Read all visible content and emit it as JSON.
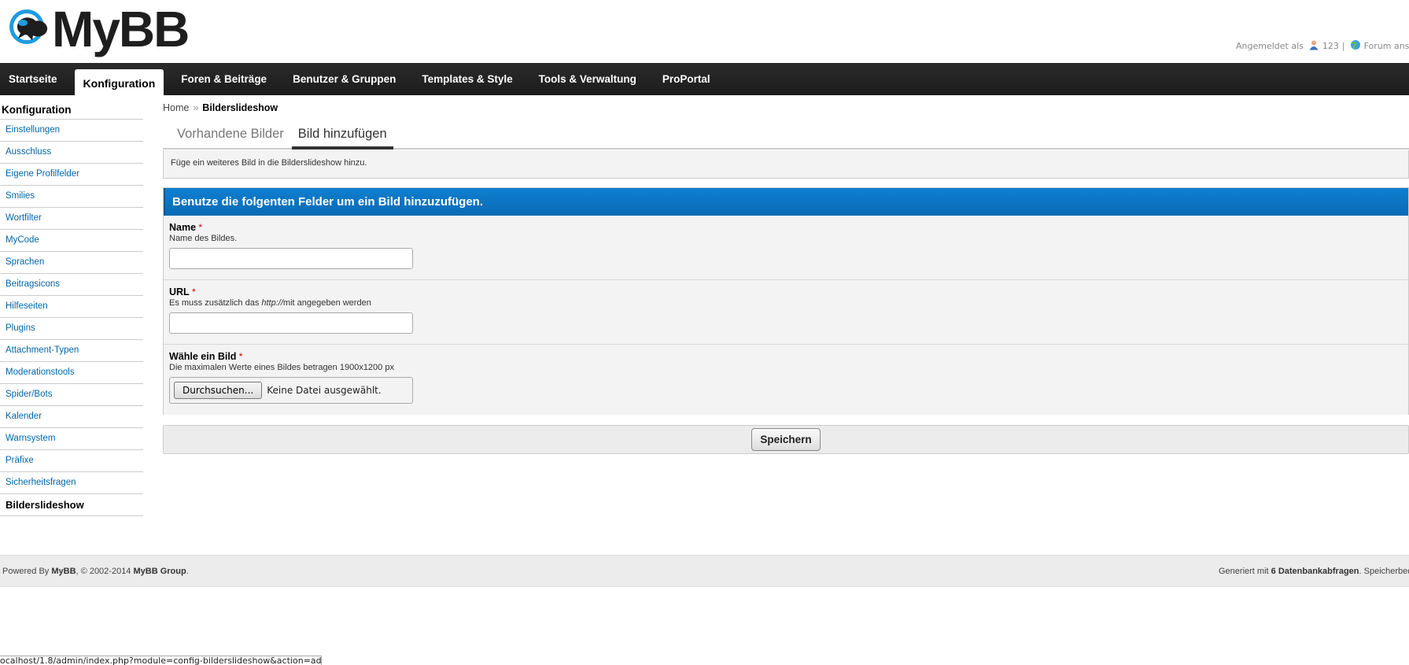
{
  "brand": {
    "name": "MyBB"
  },
  "user": {
    "logged_in_label": "Angemeldet als",
    "username": "123",
    "separator": "|",
    "view_forum": "Forum ansehen"
  },
  "nav": {
    "items": [
      {
        "label": "Startseite"
      },
      {
        "label": "Konfiguration"
      },
      {
        "label": "Foren & Beiträge"
      },
      {
        "label": "Benutzer & Gruppen"
      },
      {
        "label": "Templates & Style"
      },
      {
        "label": "Tools & Verwaltung"
      },
      {
        "label": "ProPortal"
      }
    ],
    "active": "Konfiguration"
  },
  "sidebar": {
    "title": "Konfiguration",
    "items": [
      {
        "label": "Einstellungen"
      },
      {
        "label": "Ausschluss"
      },
      {
        "label": "Eigene Profilfelder"
      },
      {
        "label": "Smilies"
      },
      {
        "label": "Wortfilter"
      },
      {
        "label": "MyCode"
      },
      {
        "label": "Sprachen"
      },
      {
        "label": "Beitragsicons"
      },
      {
        "label": "Hilfeseiten"
      },
      {
        "label": "Plugins"
      },
      {
        "label": "Attachment-Typen"
      },
      {
        "label": "Moderationstools"
      },
      {
        "label": "Spider/Bots"
      },
      {
        "label": "Kalender"
      },
      {
        "label": "Warnsystem"
      },
      {
        "label": "Präfixe"
      },
      {
        "label": "Sicherheitsfragen"
      },
      {
        "label": "Bilderslideshow"
      }
    ],
    "active": "Bilderslideshow"
  },
  "breadcrumb": {
    "home": "Home",
    "separator": "»",
    "current": "Bilderslideshow"
  },
  "tabs": [
    {
      "label": "Vorhandene Bilder"
    },
    {
      "label": "Bild hinzufügen"
    }
  ],
  "notice": "Füge ein weiteres Bild in die Bilderslideshow hinzu.",
  "form": {
    "heading": "Benutze die folgenten Felder um ein Bild hinzuzufügen.",
    "required_marker": "*",
    "name": {
      "label": "Name",
      "description": "Name des Bildes.",
      "value": ""
    },
    "url": {
      "label": "URL",
      "description_before": "Es muss zusätzlich das ",
      "description_italic": "http://",
      "description_after": "mit angegeben werden",
      "value": ""
    },
    "image": {
      "label": "Wähle ein Bild",
      "description": "Die maximalen Werte eines Bildes betragen 1900x1200 px",
      "button": "Durchsuchen...",
      "status": "Keine Datei ausgewählt."
    },
    "submit": "Speichern"
  },
  "footer": {
    "powered_by": "Powered By",
    "mybb": "MyBB",
    "copyright": ", © 2002-2014",
    "group": "MyBB Group",
    "period": ".",
    "generated": "Generiert mit",
    "queries": "6 Datenbankabfragen",
    "memory": ". Speicherbedarf"
  },
  "statusbar": "ocalhost/1.8/admin/index.php?module=config-bilderslideshow&action=add",
  "colors": {
    "nav_bg": "#222222",
    "form_header": "#0a6ab4",
    "link": "#0066aa",
    "required": "#cc0000"
  }
}
